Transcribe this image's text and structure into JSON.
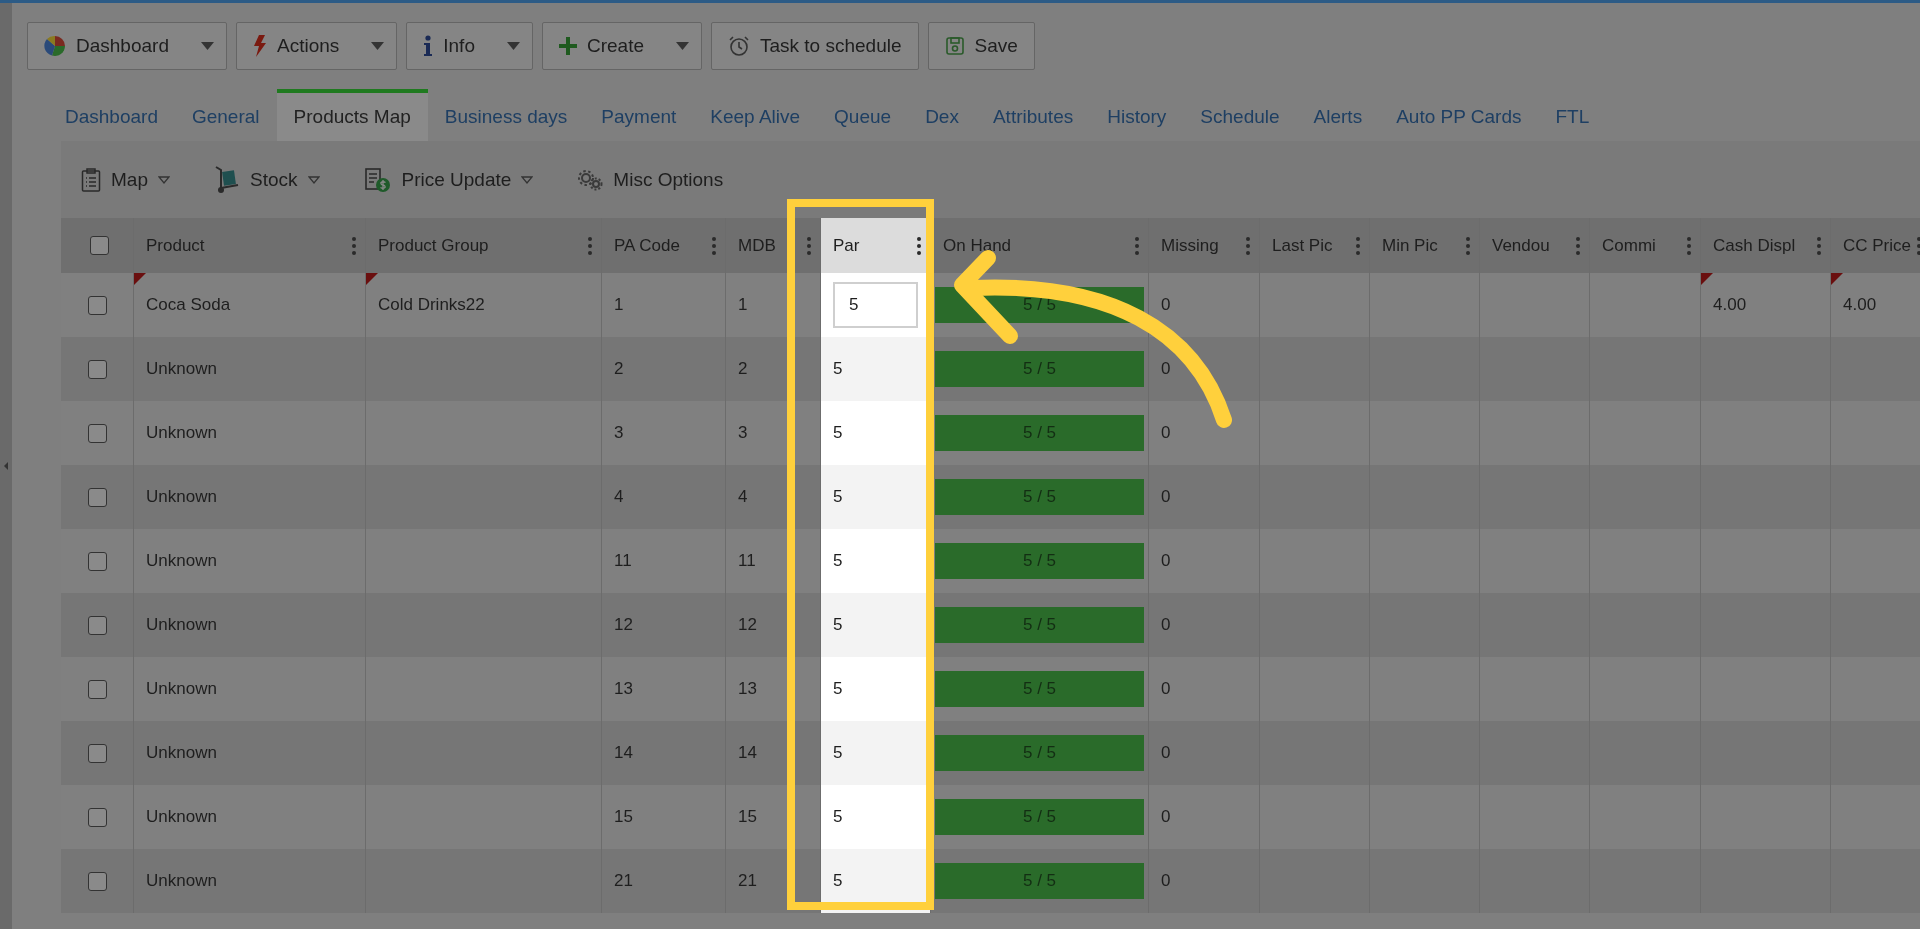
{
  "toolbar": [
    {
      "label": "Dashboard",
      "dropdown": true
    },
    {
      "label": "Actions",
      "dropdown": true
    },
    {
      "label": "Info",
      "dropdown": true
    },
    {
      "label": "Create",
      "dropdown": true
    },
    {
      "label": "Task to schedule",
      "dropdown": false
    },
    {
      "label": "Save",
      "dropdown": false
    }
  ],
  "tabs": [
    {
      "label": "Dashboard",
      "selected": false
    },
    {
      "label": "General",
      "selected": false
    },
    {
      "label": "Products Map",
      "selected": true
    },
    {
      "label": "Business days",
      "selected": false
    },
    {
      "label": "Payment",
      "selected": false
    },
    {
      "label": "Keep Alive",
      "selected": false
    },
    {
      "label": "Queue",
      "selected": false
    },
    {
      "label": "Dex",
      "selected": false
    },
    {
      "label": "Attributes",
      "selected": false
    },
    {
      "label": "History",
      "selected": false
    },
    {
      "label": "Schedule",
      "selected": false
    },
    {
      "label": "Alerts",
      "selected": false
    },
    {
      "label": "Auto PP Cards",
      "selected": false
    },
    {
      "label": "FTL",
      "selected": false
    }
  ],
  "subtoolbar": [
    {
      "label": "Map",
      "dropdown": true
    },
    {
      "label": "Stock",
      "dropdown": true
    },
    {
      "label": "Price Update",
      "dropdown": true
    },
    {
      "label": "Misc Options",
      "dropdown": false
    }
  ],
  "grid": {
    "select_all": {
      "checked": false
    },
    "columns": [
      {
        "label": "Product",
        "highlighted": false
      },
      {
        "label": "Product Group",
        "highlighted": false
      },
      {
        "label": "PA Code",
        "highlighted": false
      },
      {
        "label": "MDB",
        "highlighted": false
      },
      {
        "label": "Par",
        "highlighted": true
      },
      {
        "label": "On Hand",
        "highlighted": false
      },
      {
        "label": "Missing",
        "highlighted": false
      },
      {
        "label": "Last Pic",
        "highlighted": false
      },
      {
        "label": "Min Pic",
        "highlighted": false
      },
      {
        "label": "Vendou",
        "highlighted": false
      },
      {
        "label": "Commi",
        "highlighted": false
      },
      {
        "label": "Cash Displ",
        "highlighted": false
      },
      {
        "label": "CC Price",
        "highlighted": false
      }
    ],
    "rows": [
      {
        "checked": false,
        "editing": true,
        "product": "Coca Soda",
        "group": "Cold Drinks22",
        "pa_code": "1",
        "mdb": "1",
        "par": "5",
        "on_hand": "5 / 5",
        "level": 1,
        "missing": "0",
        "cash_display": "4.00",
        "cc_price": "4.00",
        "flagged": true
      },
      {
        "checked": false,
        "editing": false,
        "product": "Unknown",
        "pa_code": "2",
        "mdb": "2",
        "par": "5",
        "on_hand": "5 / 5",
        "level": 1,
        "missing": "0",
        "flagged": false
      },
      {
        "checked": false,
        "editing": false,
        "product": "Unknown",
        "pa_code": "3",
        "mdb": "3",
        "par": "5",
        "on_hand": "5 / 5",
        "level": 1,
        "missing": "0",
        "flagged": false
      },
      {
        "checked": false,
        "editing": false,
        "product": "Unknown",
        "pa_code": "4",
        "mdb": "4",
        "par": "5",
        "on_hand": "5 / 5",
        "level": 1,
        "missing": "0",
        "flagged": false
      },
      {
        "checked": false,
        "editing": false,
        "product": "Unknown",
        "pa_code": "11",
        "mdb": "11",
        "par": "5",
        "on_hand": "5 / 5",
        "level": 1,
        "missing": "0",
        "flagged": false
      },
      {
        "checked": false,
        "editing": false,
        "product": "Unknown",
        "pa_code": "12",
        "mdb": "12",
        "par": "5",
        "on_hand": "5 / 5",
        "level": 1,
        "missing": "0",
        "flagged": false
      },
      {
        "checked": false,
        "editing": false,
        "product": "Unknown",
        "pa_code": "13",
        "mdb": "13",
        "par": "5",
        "on_hand": "5 / 5",
        "level": 1,
        "missing": "0",
        "flagged": false
      },
      {
        "checked": false,
        "editing": false,
        "product": "Unknown",
        "pa_code": "14",
        "mdb": "14",
        "par": "5",
        "on_hand": "5 / 5",
        "level": 1,
        "missing": "0",
        "flagged": false
      },
      {
        "checked": false,
        "editing": false,
        "product": "Unknown",
        "pa_code": "15",
        "mdb": "15",
        "par": "5",
        "on_hand": "5 / 5",
        "level": 1,
        "missing": "0",
        "flagged": false
      },
      {
        "checked": false,
        "editing": false,
        "product": "Unknown",
        "pa_code": "21",
        "mdb": "21",
        "par": "5",
        "on_hand": "5 / 5",
        "level": 1,
        "missing": "0",
        "flagged": false
      }
    ]
  }
}
